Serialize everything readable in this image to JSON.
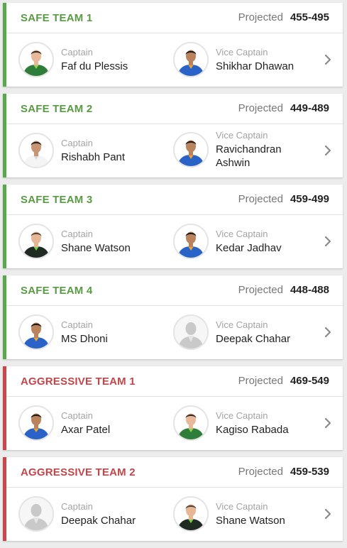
{
  "projected_label": "Projected",
  "captain_label": "Captain",
  "vice_captain_label": "Vice Captain",
  "colors": {
    "safe": "#5aa84c",
    "aggressive": "#c9474a"
  },
  "teams": [
    {
      "name": "SAFE TEAM 1",
      "type": "safe",
      "projected": "455-495",
      "captain": {
        "name": "Faf du Plessis",
        "avatar": "player-green-kit-avatar"
      },
      "vice_captain": {
        "name": "Shikhar Dhawan",
        "avatar": "player-blue-kit-avatar"
      }
    },
    {
      "name": "SAFE TEAM 2",
      "type": "safe",
      "projected": "449-489",
      "captain": {
        "name": "Rishabh Pant",
        "avatar": "player-white-kit-avatar"
      },
      "vice_captain": {
        "name": "Ravichandran Ashwin",
        "avatar": "player-blue-kit-avatar"
      }
    },
    {
      "name": "SAFE TEAM 3",
      "type": "safe",
      "projected": "459-499",
      "captain": {
        "name": "Shane Watson",
        "avatar": "player-dark-kit-avatar"
      },
      "vice_captain": {
        "name": "Kedar Jadhav",
        "avatar": "player-blue-kit-avatar"
      }
    },
    {
      "name": "SAFE TEAM 4",
      "type": "safe",
      "projected": "448-488",
      "captain": {
        "name": "MS Dhoni",
        "avatar": "player-blue-kit-avatar"
      },
      "vice_captain": {
        "name": "Deepak Chahar",
        "avatar": "placeholder-person-avatar"
      }
    },
    {
      "name": "AGGRESSIVE TEAM 1",
      "type": "aggressive",
      "projected": "469-549",
      "captain": {
        "name": "Axar Patel",
        "avatar": "player-blue-kit-avatar"
      },
      "vice_captain": {
        "name": "Kagiso Rabada",
        "avatar": "player-green-kit-avatar"
      }
    },
    {
      "name": "AGGRESSIVE TEAM 2",
      "type": "aggressive",
      "projected": "459-539",
      "captain": {
        "name": "Deepak Chahar",
        "avatar": "placeholder-person-avatar"
      },
      "vice_captain": {
        "name": "Shane Watson",
        "avatar": "player-dark-kit-avatar"
      }
    }
  ]
}
